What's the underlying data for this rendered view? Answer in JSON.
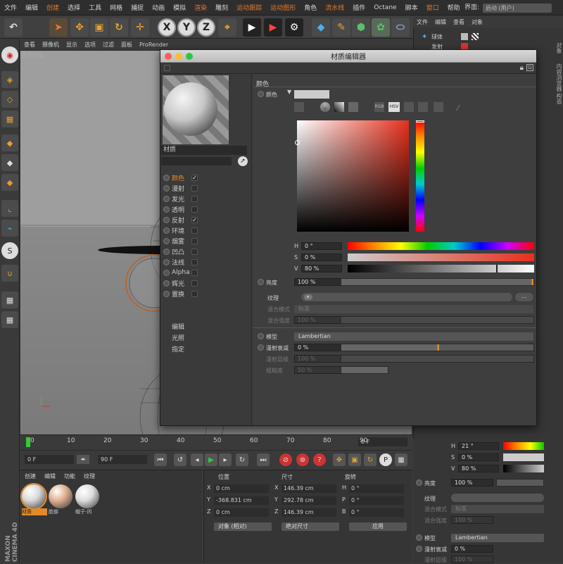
{
  "menubar": {
    "items": [
      {
        "label": "文件",
        "orange": false
      },
      {
        "label": "编辑",
        "orange": false
      },
      {
        "label": "创建",
        "orange": true
      },
      {
        "label": "选择",
        "orange": false
      },
      {
        "label": "工具",
        "orange": false
      },
      {
        "label": "网格",
        "orange": false
      },
      {
        "label": "捕捉",
        "orange": false
      },
      {
        "label": "动画",
        "orange": false
      },
      {
        "label": "模拟",
        "orange": false
      },
      {
        "label": "渲染",
        "orange": true
      },
      {
        "label": "雕刻",
        "orange": false
      },
      {
        "label": "运动跟踪",
        "orange": true
      },
      {
        "label": "运动图形",
        "orange": true
      },
      {
        "label": "角色",
        "orange": false
      },
      {
        "label": "流水线",
        "orange": true
      },
      {
        "label": "插件",
        "orange": false
      },
      {
        "label": "Octane",
        "orange": false
      },
      {
        "label": "脚本",
        "orange": false
      },
      {
        "label": "窗口",
        "orange": true
      },
      {
        "label": "帮助",
        "orange": false
      }
    ],
    "layout_label": "界面:",
    "layout_value": "启动 (用户)"
  },
  "viewport": {
    "menu": [
      "查看",
      "摄像机",
      "显示",
      "选项",
      "过滤",
      "面板",
      "ProRender"
    ],
    "title": "透视视图"
  },
  "object_panel": {
    "menu": [
      "文件",
      "编辑",
      "查看",
      "对象"
    ],
    "items": [
      "球体",
      "发射"
    ],
    "side_tabs": [
      "对象",
      "内容浏览器",
      "构造"
    ]
  },
  "material_editor": {
    "title": "材质编辑器",
    "material_name": "材质",
    "channels": [
      {
        "label": "颜色",
        "checked": true,
        "active": true
      },
      {
        "label": "漫射",
        "checked": false,
        "active": false
      },
      {
        "label": "发光",
        "checked": false,
        "active": false
      },
      {
        "label": "透明",
        "checked": false,
        "active": false
      },
      {
        "label": "反射",
        "checked": true,
        "active": false
      },
      {
        "label": "环境",
        "checked": false,
        "active": false
      },
      {
        "label": "烟雾",
        "checked": false,
        "active": false
      },
      {
        "label": "凹凸",
        "checked": false,
        "active": false
      },
      {
        "label": "法线",
        "checked": false,
        "active": false
      },
      {
        "label": "Alpha",
        "checked": false,
        "active": false
      },
      {
        "label": "辉光",
        "checked": false,
        "active": false
      },
      {
        "label": "置换",
        "checked": false,
        "active": false
      }
    ],
    "extra": [
      "编辑",
      "光照",
      "指定"
    ],
    "section_title": "颜色",
    "color_label": "颜色",
    "hsv_mode": "HSV",
    "h": {
      "label": "H",
      "value": "0 °"
    },
    "s": {
      "label": "S",
      "value": "0 %"
    },
    "v": {
      "label": "V",
      "value": "80 %",
      "fraction": 0.8
    },
    "brightness": {
      "label": "亮度",
      "value": "100 %"
    },
    "texture_label": "纹理",
    "blend_mode": {
      "label": "混合模式",
      "value": "标准"
    },
    "blend_strength": {
      "label": "混合强度",
      "value": "100 %"
    },
    "model": {
      "label": "模型",
      "value": "Lambertian"
    },
    "diffuse_falloff": {
      "label": "漫射衰减",
      "value": "0 %"
    },
    "diffuse_level": {
      "label": "漫射层级",
      "value": "100 %"
    },
    "roughness": {
      "label": "粗糙度",
      "value": "50 %"
    },
    "colors": {
      "accent": "#e08a2a"
    }
  },
  "timeline": {
    "ticks": [
      "0",
      "10",
      "20",
      "30",
      "40",
      "50",
      "60",
      "70",
      "80",
      "90"
    ],
    "end_field": "0 F"
  },
  "controls": {
    "start_field": "0 F",
    "end_field": "90 F"
  },
  "material_manager": {
    "menu": [
      "创建",
      "编辑",
      "功能",
      "纹理"
    ],
    "materials": [
      "材质",
      "脸部",
      "帽子-凹"
    ]
  },
  "coordinates": {
    "headers": [
      "位置",
      "尺寸",
      "旋转"
    ],
    "rows": [
      {
        "axis": "X",
        "pos": "0 cm",
        "size_axis": "X",
        "size": "146.39 cm",
        "rot_axis": "H",
        "rot": "0 °"
      },
      {
        "axis": "Y",
        "pos": "-368.831 cm",
        "size_axis": "Y",
        "size": "292.78 cm",
        "rot_axis": "P",
        "rot": "0 °"
      },
      {
        "axis": "Z",
        "pos": "0 cm",
        "size_axis": "Z",
        "size": "146.39 cm",
        "rot_axis": "B",
        "rot": "0 °"
      }
    ],
    "mode1": "对象 (相对)",
    "mode2": "绝对尺寸",
    "apply": "应用"
  },
  "attr_bottom": {
    "h": "21 °",
    "s": "0 %",
    "v": "80 %",
    "brightness": {
      "label": "亮度",
      "value": "100 %"
    },
    "texture_label": "纹理",
    "blend_mode": {
      "label": "混合模式",
      "value": "标准"
    },
    "blend_strength": {
      "label": "混合强度",
      "value": "100 %"
    },
    "model": {
      "label": "模型",
      "value": "Lambertian"
    },
    "diffuse_falloff": {
      "label": "漫射衰减",
      "value": "0 %"
    },
    "diffuse_level": {
      "label": "漫射层级",
      "value": "100 %"
    }
  },
  "brand": "MAXON CINEMA 4D"
}
